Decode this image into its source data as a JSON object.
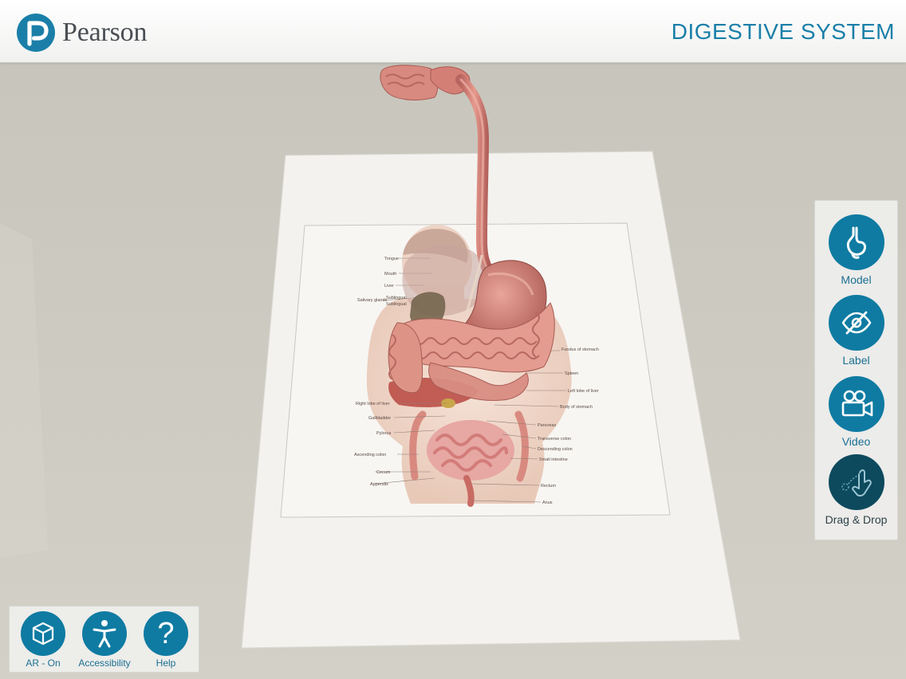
{
  "header": {
    "brand_name": "Pearson",
    "title": "DIGESTIVE SYSTEM"
  },
  "poster": {
    "labels_left": [
      "Tongue",
      "Mouth",
      "Liver",
      "Salivary glands",
      "Sublingual",
      "Sublingual",
      "Right lobe of liver",
      "Gallbladder",
      "Pylorus",
      "Ascending colon",
      "Cecum",
      "Appendix"
    ],
    "labels_right": [
      "Fundus of stomach",
      "Spleen",
      "Left lobe of liver",
      "Body of stomach",
      "Pancreas",
      "Transverse colon",
      "Descending colon",
      "Small intestine",
      "Rectum",
      "Anus"
    ]
  },
  "tools": [
    {
      "label": "Model",
      "icon": "stomach-icon"
    },
    {
      "label": "Label",
      "icon": "eye-slash-icon"
    },
    {
      "label": "Video",
      "icon": "video-camera-icon"
    },
    {
      "label": "Drag & Drop",
      "icon": "hand-drag-icon"
    }
  ],
  "bottom_buttons": [
    {
      "label": "AR - On",
      "icon": "cube-icon"
    },
    {
      "label": "Accessibility",
      "icon": "accessibility-icon"
    },
    {
      "label": "Help",
      "icon": "help-icon",
      "glyph": "?"
    }
  ],
  "colors": {
    "accent": "#0f7ba2",
    "accent_dark": "#0d4a5e",
    "title_blue": "#1a7fa8",
    "organ_pink": "#d98a80"
  }
}
